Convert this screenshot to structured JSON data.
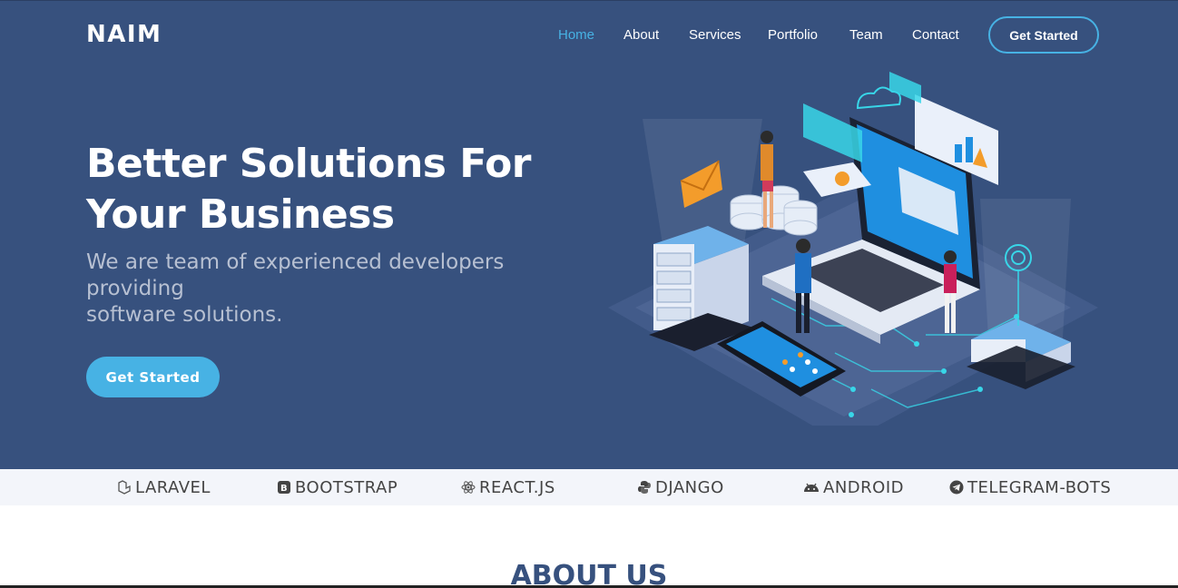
{
  "brand": {
    "logo": "NAIM"
  },
  "nav": {
    "items": [
      {
        "label": "Home",
        "active": true
      },
      {
        "label": "About",
        "active": false
      },
      {
        "label": "Services",
        "active": false
      },
      {
        "label": "Portfolio",
        "active": false
      },
      {
        "label": "Team",
        "active": false
      },
      {
        "label": "Contact",
        "active": false
      }
    ],
    "cta": "Get Started"
  },
  "hero": {
    "title_line1": "Better Solutions For",
    "title_line2": "Your Business",
    "subtitle_line1": "We are team of experienced developers providing",
    "subtitle_line2": "software solutions.",
    "button": "Get Started",
    "illustration_icon": "laptop-servers-illustration"
  },
  "technologies": [
    {
      "label": "LARAVEL",
      "icon": "laravel-icon"
    },
    {
      "label": "BOOTSTRAP",
      "icon": "bootstrap-icon"
    },
    {
      "label": "REACT.JS",
      "icon": "react-icon"
    },
    {
      "label": "DJANGO",
      "icon": "python-icon"
    },
    {
      "label": "ANDROID",
      "icon": "android-icon"
    },
    {
      "label": "TELEGRAM-BOTS",
      "icon": "telegram-icon"
    }
  ],
  "about": {
    "title": "ABOUT US"
  },
  "colors": {
    "hero_bg": "#37517e",
    "accent": "#47b2e4",
    "tech_bar_bg": "#f3f5fa",
    "about_title": "#37517e"
  }
}
